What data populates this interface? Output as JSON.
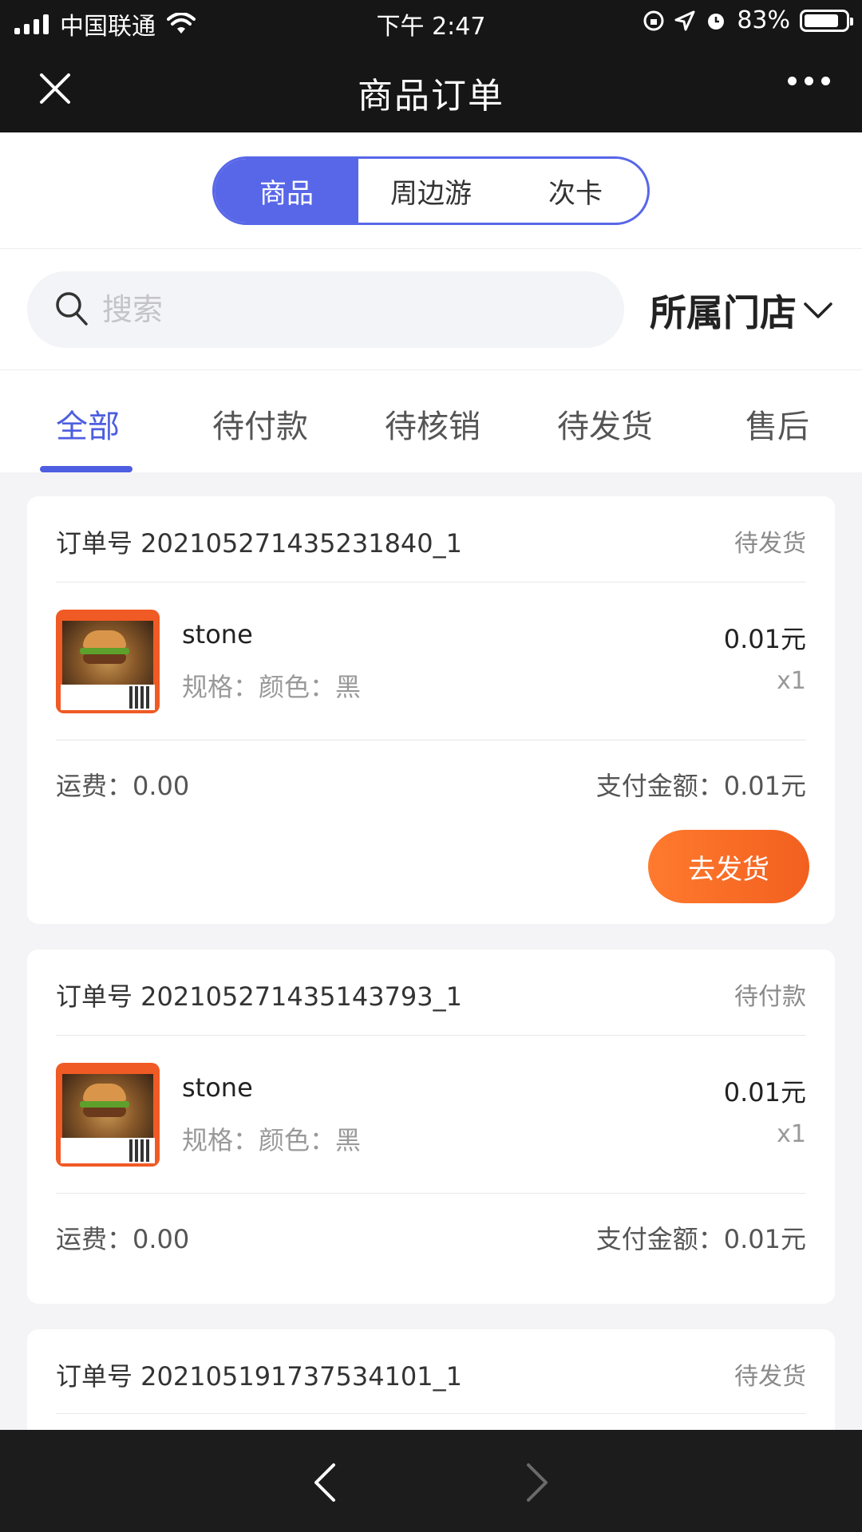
{
  "status_bar": {
    "carrier": "中国联通",
    "time": "下午 2:47",
    "battery": "83%",
    "battery_level": 0.83
  },
  "nav": {
    "title": "商品订单"
  },
  "segments": {
    "items": [
      "商品",
      "周边游",
      "次卡"
    ],
    "active_index": 0
  },
  "search": {
    "placeholder": "搜索",
    "store_filter": "所属门店"
  },
  "tabs": {
    "items": [
      "全部",
      "待付款",
      "待核销",
      "待发货",
      "售后"
    ],
    "active_index": 0
  },
  "orders": [
    {
      "order_no": "订单号 202105271435231840_1",
      "status": "待发货",
      "product_name": "stone",
      "spec": "规格：颜色：黑",
      "price": "0.01元",
      "qty": "x1",
      "freight": "运费：0.00",
      "paid": "支付金额：0.01元",
      "action": "去发货"
    },
    {
      "order_no": "订单号 202105271435143793_1",
      "status": "待付款",
      "product_name": "stone",
      "spec": "规格：颜色：黑",
      "price": "0.01元",
      "qty": "x1",
      "freight": "运费：0.00",
      "paid": "支付金额：0.01元"
    },
    {
      "order_no": "订单号 202105191737534101_1",
      "status": "待发货"
    }
  ],
  "colors": {
    "accent": "#4d5ee0",
    "action": "#f2601f",
    "bar": "#161616"
  }
}
